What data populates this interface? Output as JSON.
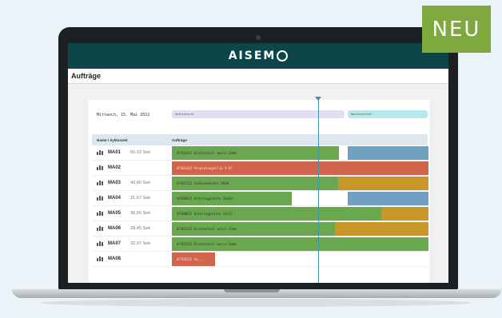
{
  "badge": "NEU",
  "header": {
    "logo_prefix": "AISEM",
    "logo_suffix": "O"
  },
  "page": {
    "title": "Aufträge"
  },
  "timeline": {
    "date": "Mittwoch, 15. Mai 2022",
    "shifts": [
      {
        "label": "Spätschicht"
      },
      {
        "label": "Nachtschicht"
      }
    ]
  },
  "table": {
    "columns": [
      "Name / Zykluszeit",
      "Aufträge"
    ],
    "rows": [
      {
        "name": "MA01",
        "cycle": "60,33 Sek",
        "orders": [
          "AF301422 Distanzteil weiss-20mm",
          ""
        ]
      },
      {
        "name": "MA02",
        "cycle": "",
        "orders": [
          "AF301422 Verpackungsclip V-07"
        ]
      },
      {
        "name": "MA03",
        "cycle": "40,40 Sek",
        "orders": [
          "AF301722 Gehäusedeckel D938",
          ""
        ]
      },
      {
        "name": "MA04",
        "cycle": "31,67 Sek",
        "orders": [
          "AF300922 Unterlegplatte 30x30",
          ""
        ]
      },
      {
        "name": "MA05",
        "cycle": "36,65 Sek",
        "orders": [
          "AF300022 Unterlegplatte 15x15",
          ""
        ]
      },
      {
        "name": "MA06",
        "cycle": "28,45 Sek",
        "orders": [
          "AF301222 Distanzteil weiss-15mm",
          ""
        ]
      },
      {
        "name": "MA07",
        "cycle": "32,07 Sek",
        "orders": [
          "AF301222 Distanzteil weiss-10mm"
        ]
      },
      {
        "name": "MA08",
        "cycle": "",
        "orders": [
          "AF350122 Sa..."
        ]
      }
    ]
  },
  "colors": {
    "header_bg": "#0d4649",
    "running": "#6aa84f",
    "stopped": "#d1644c",
    "planned": "#6fa0c2",
    "warning": "#c9962a",
    "now_line": "#3d97a2",
    "badge": "#7fa83f"
  }
}
